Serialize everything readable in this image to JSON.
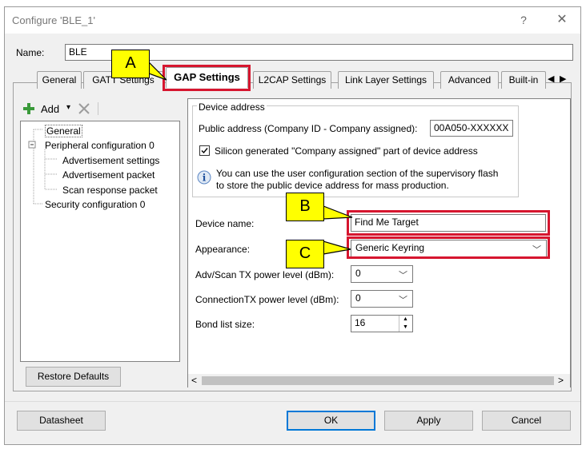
{
  "window": {
    "title": "Configure 'BLE_1'",
    "help": "?",
    "close": "✕"
  },
  "name_field": {
    "label": "Name:",
    "value": "BLE"
  },
  "tabs": [
    {
      "label": "General"
    },
    {
      "label": "GATT Settings"
    },
    {
      "label": "GAP Settings",
      "selected": true
    },
    {
      "label": "L2CAP Settings"
    },
    {
      "label": "Link Layer Settings"
    },
    {
      "label": "Advanced"
    },
    {
      "label": "Built-in"
    }
  ],
  "tab_scroll": {
    "left": "◀",
    "right": "▶"
  },
  "left_pane": {
    "add_label": "Add",
    "add_icon": "plus-icon",
    "delete_icon": "delete-x-icon",
    "tree": [
      {
        "label": "General",
        "level": 0,
        "selected": true
      },
      {
        "label": "Peripheral configuration 0",
        "level": 0,
        "expand": "−"
      },
      {
        "label": "Advertisement settings",
        "level": 1
      },
      {
        "label": "Advertisement packet",
        "level": 1
      },
      {
        "label": "Scan response packet",
        "level": 1
      },
      {
        "label": "Security configuration 0",
        "level": 0
      }
    ],
    "restore_defaults": "Restore Defaults"
  },
  "device_address": {
    "group_title": "Device address",
    "public_label": "Public address (Company ID - Company assigned):",
    "public_value": "00A050-XXXXXX",
    "silicon_label": "Silicon generated \"Company assigned\" part of device address",
    "silicon_checked": true,
    "info_line1": "You can use the user configuration section of the supervisory flash",
    "info_line2": "to store the public device address for mass production."
  },
  "fields": {
    "device_name_label": "Device name:",
    "device_name_value": "Find Me Target",
    "appearance_label": "Appearance:",
    "appearance_value": "Generic Keyring",
    "adv_tx_label": "Adv/Scan TX power level (dBm):",
    "adv_tx_value": "0",
    "conn_tx_label": "ConnectionTX power level (dBm):",
    "conn_tx_value": "0",
    "bond_label": "Bond list size:",
    "bond_value": "16"
  },
  "callouts": {
    "a": "A",
    "b": "B",
    "c": "C"
  },
  "colors": {
    "highlight": "#d6162f",
    "callout": "#ffff00"
  },
  "footer": {
    "datasheet": "Datasheet",
    "ok": "OK",
    "apply": "Apply",
    "cancel": "Cancel"
  },
  "scroll": {
    "left": "<",
    "right": ">"
  }
}
